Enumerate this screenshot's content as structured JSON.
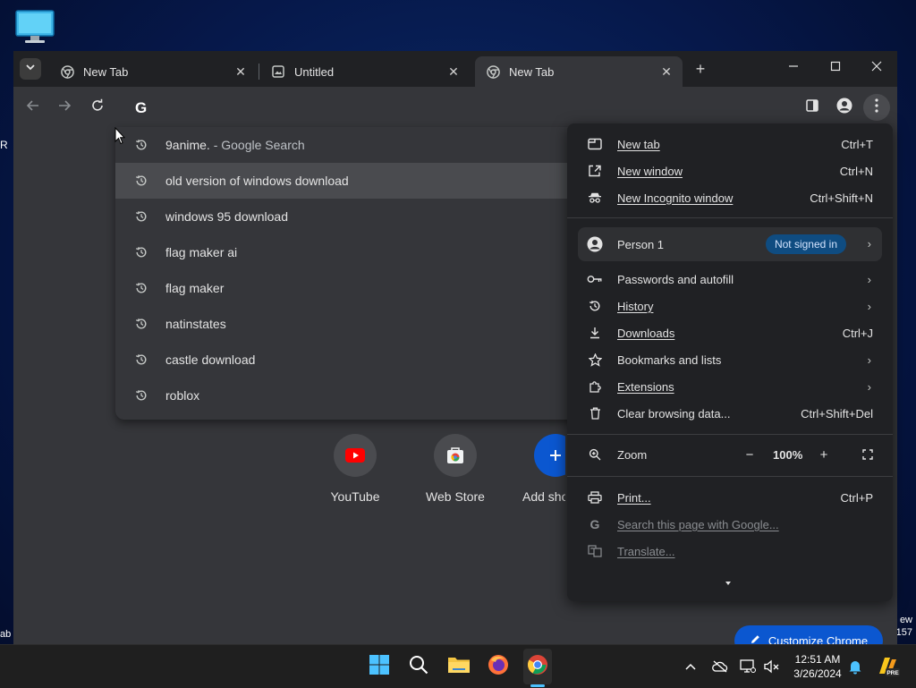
{
  "desktop": {
    "left_fragment_1": "R",
    "left_fragment_2": "ab",
    "right_fragment_1": "ew",
    "right_fragment_2": "157"
  },
  "tabs": [
    {
      "title": "New Tab",
      "icon": "chrome-icon",
      "active": false
    },
    {
      "title": "Untitled",
      "icon": "image-icon",
      "active": false
    },
    {
      "title": "New Tab",
      "icon": "chrome-icon",
      "active": true
    }
  ],
  "omnibox": {
    "suggestions": [
      {
        "text": "9anime.",
        "desc": " - Google Search"
      },
      {
        "text": "old version of windows download",
        "desc": ""
      },
      {
        "text": "windows 95 download",
        "desc": ""
      },
      {
        "text": "flag maker ai",
        "desc": ""
      },
      {
        "text": "flag maker",
        "desc": ""
      },
      {
        "text": "natinstates",
        "desc": ""
      },
      {
        "text": "castle download",
        "desc": ""
      },
      {
        "text": "roblox",
        "desc": ""
      }
    ]
  },
  "shortcuts": [
    {
      "label": "YouTube"
    },
    {
      "label": "Web Store"
    },
    {
      "label": "Add shortcut"
    }
  ],
  "customize_label": "Customize Chrome",
  "menu": {
    "new_tab": {
      "label": "New tab",
      "shortcut": "Ctrl+T"
    },
    "new_window": {
      "label": "New window",
      "shortcut": "Ctrl+N"
    },
    "new_incognito": {
      "label": "New Incognito window",
      "shortcut": "Ctrl+Shift+N"
    },
    "person": {
      "label": "Person 1",
      "status": "Not signed in"
    },
    "passwords": {
      "label": "Passwords and autofill"
    },
    "history": {
      "label": "History"
    },
    "downloads": {
      "label": "Downloads",
      "shortcut": "Ctrl+J"
    },
    "bookmarks": {
      "label": "Bookmarks and lists"
    },
    "extensions": {
      "label": "Extensions"
    },
    "clear_data": {
      "label": "Clear browsing data...",
      "shortcut": "Ctrl+Shift+Del"
    },
    "zoom": {
      "label": "Zoom",
      "minus": "−",
      "value": "100%",
      "plus": "+"
    },
    "print": {
      "label": "Print...",
      "shortcut": "Ctrl+P"
    },
    "search_page": {
      "label": "Search this page with Google..."
    },
    "translate": {
      "label": "Translate..."
    }
  },
  "taskbar": {
    "time": "12:51 AM",
    "date": "3/26/2024"
  },
  "colors": {
    "accent": "#0b57d0",
    "window_bg": "#35363a",
    "menu_bg": "#202124",
    "taskbar_bg": "#1f1f1f"
  }
}
